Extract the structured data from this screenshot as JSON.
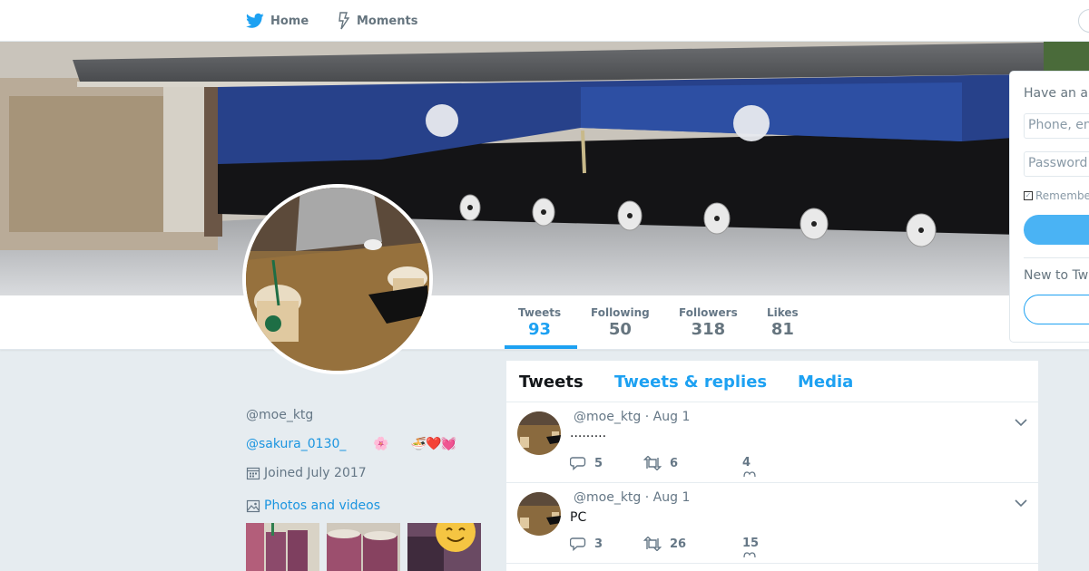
{
  "nav": {
    "home_label": "Home",
    "moments_label": "Moments"
  },
  "stats": [
    {
      "label": "Tweets",
      "value": "93"
    },
    {
      "label": "Following",
      "value": "50"
    },
    {
      "label": "Followers",
      "value": "318"
    },
    {
      "label": "Likes",
      "value": "81"
    }
  ],
  "login": {
    "heading": "Have an a",
    "phone_placeholder": "Phone, en",
    "password_placeholder": "Password",
    "remember_label": "Remembe",
    "new_label": "New to Tw"
  },
  "profile": {
    "handle": "@moe_ktg",
    "bio_mention": "@sakura_0130_",
    "bio_emoji_1": "🌸",
    "bio_emoji_2": "🍜❤️💓",
    "joined": "Joined July 2017",
    "photos_label": "Photos and videos"
  },
  "timeline": {
    "tabs": [
      "Tweets",
      "Tweets & replies",
      "Media"
    ],
    "tweets": [
      {
        "meta": "@moe_ktg · Aug 1",
        "text": "·········",
        "replies": "5",
        "retweets": "6",
        "likes": "4"
      },
      {
        "meta": "@moe_ktg · Aug 1",
        "text": "PC",
        "replies": "3",
        "retweets": "26",
        "likes": "15"
      }
    ]
  },
  "colors": {
    "accent": "#1da1f2",
    "background": "#e6ecf0",
    "link": "#1b95e0"
  }
}
